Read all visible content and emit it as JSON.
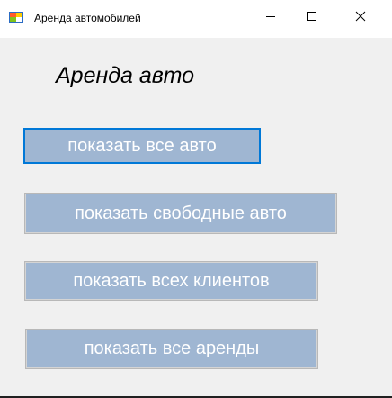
{
  "window": {
    "title": "Аренда автомобилей",
    "app_icon": "form-icon",
    "controls": {
      "minimize_icon": "minimize-icon",
      "maximize_icon": "maximize-icon",
      "close_icon": "close-icon"
    }
  },
  "main": {
    "heading": "Аренда авто",
    "buttons": [
      {
        "label": "показать все авто"
      },
      {
        "label": "показать свободные авто"
      },
      {
        "label": "показать всех клиентов"
      },
      {
        "label": "показать все аренды"
      }
    ]
  },
  "colors": {
    "button_bg": "#9fb6d2",
    "button_text": "#ffffff",
    "focus_border": "#0078d7",
    "window_bg": "#f0f0f0"
  }
}
